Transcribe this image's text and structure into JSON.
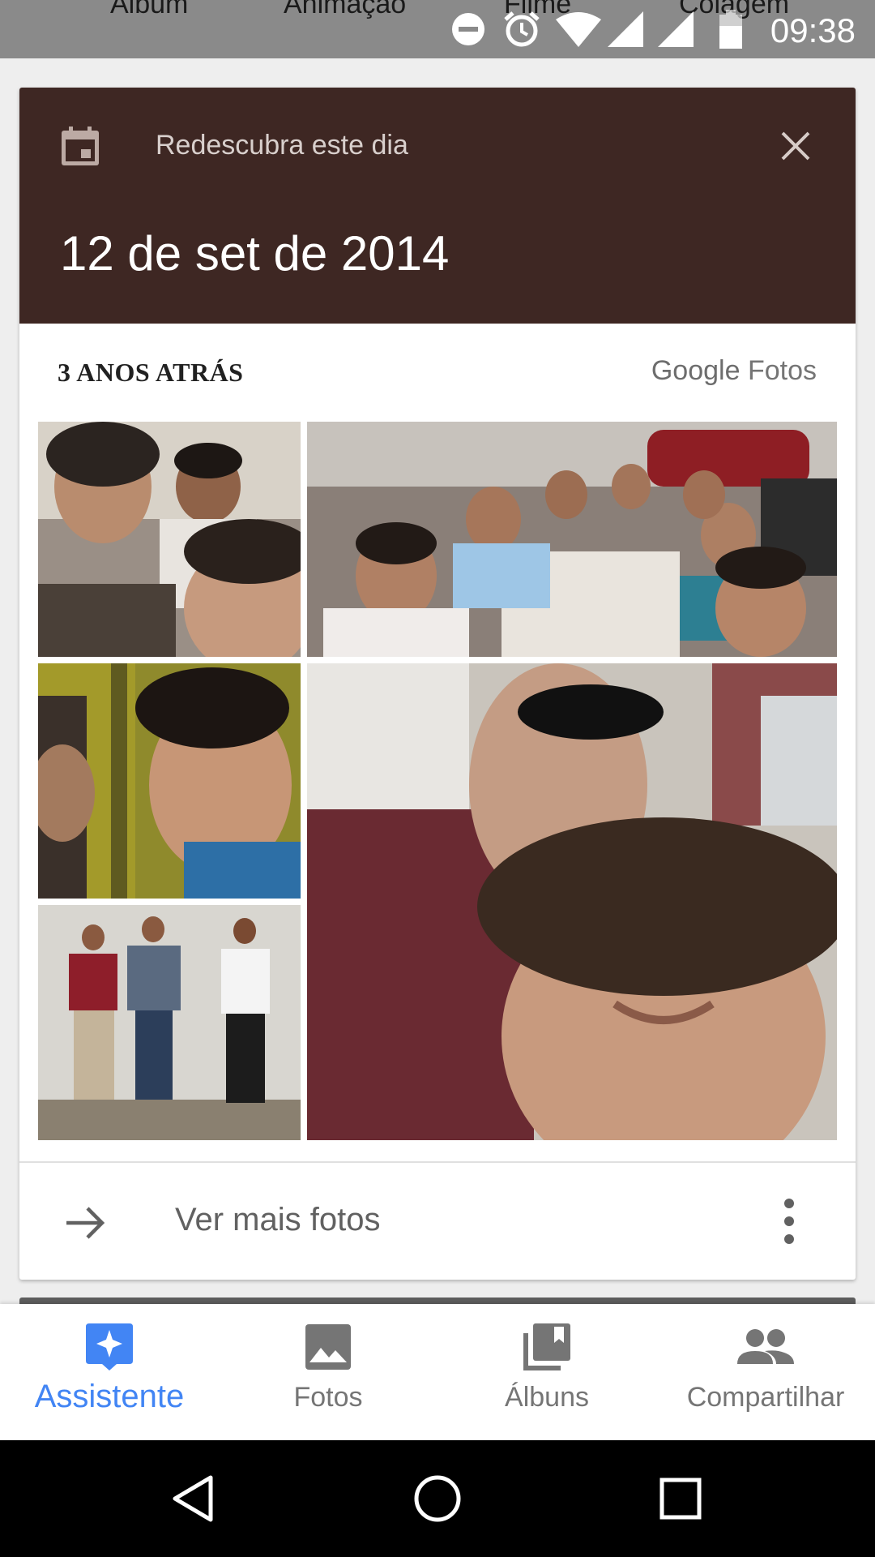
{
  "status_bar": {
    "time": "09:38",
    "background_tabs": [
      "Álbum",
      "Animação",
      "Filme",
      "Colagem"
    ],
    "icons": [
      "do-not-disturb-icon",
      "alarm-icon",
      "wifi-icon",
      "signal-icon",
      "signal-icon-2",
      "battery-icon"
    ]
  },
  "memory_card": {
    "header_color": "#3e2723",
    "subtitle": "Redescubra este dia",
    "date": "12 de set de 2014",
    "section_label": "3 ANOS ATRÁS",
    "brand": {
      "google": "Google",
      "product": "Fotos"
    },
    "photos": [
      {
        "name": "photo-selfie-three-friends"
      },
      {
        "name": "photo-group-restaurant"
      },
      {
        "name": "photo-selfie-yellow-door"
      },
      {
        "name": "photo-selfie-car"
      },
      {
        "name": "photo-three-friends-wall"
      }
    ],
    "footer": {
      "action_label": "Ver mais fotos",
      "icons": [
        "arrow-forward-icon",
        "more-vert-icon"
      ]
    }
  },
  "bottom_nav": {
    "accent_color": "#4285f4",
    "items": [
      {
        "label": "Assistente",
        "icon": "assistant-icon",
        "active": true
      },
      {
        "label": "Fotos",
        "icon": "photo-icon",
        "active": false
      },
      {
        "label": "Álbuns",
        "icon": "albums-icon",
        "active": false
      },
      {
        "label": "Compartilhar",
        "icon": "people-icon",
        "active": false
      }
    ]
  },
  "system_nav": {
    "buttons": [
      "back-icon",
      "home-icon",
      "recents-icon"
    ]
  }
}
